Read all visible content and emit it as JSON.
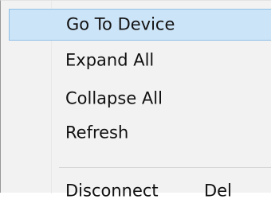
{
  "context_menu": {
    "items": [
      {
        "label": "Go To Device",
        "shortcut": "",
        "highlighted": true
      },
      {
        "label": "Expand All",
        "shortcut": ""
      },
      {
        "label": "Collapse All",
        "shortcut": ""
      },
      {
        "label": "Refresh",
        "shortcut": ""
      },
      {
        "label": "Disconnect",
        "shortcut": "Del"
      }
    ],
    "colors": {
      "background": "#f2f2f2",
      "highlight": "#cce4f7",
      "highlight_border": "#8fc0e8",
      "separator": "#d4d4d4",
      "text": "#111111"
    }
  }
}
